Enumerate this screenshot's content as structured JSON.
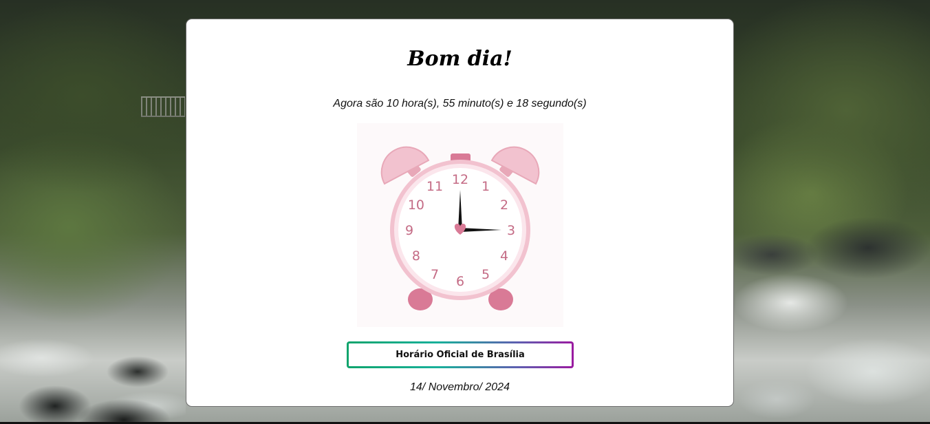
{
  "page": {
    "greeting": "Bom dia!",
    "time_text": "Agora são 10 hora(s), 55 minuto(s) e 18 segundo(s)",
    "official_time_button": "Horário Oficial de Brasília",
    "date_text": "14/ Novembro/ 2024"
  },
  "clock": {
    "icon": "alarm-clock-icon",
    "numerals": [
      "12",
      "1",
      "2",
      "3",
      "4",
      "5",
      "6",
      "7",
      "8",
      "9",
      "10",
      "11"
    ],
    "shown_hour": 3,
    "shown_minute": 0,
    "colors": {
      "pink_light": "#f2c2cf",
      "pink_medium": "#e8a8b8",
      "pink_dark": "#d97a96",
      "hands": "#111111",
      "numerals": "#c46b85"
    }
  },
  "button_gradient": [
    "#0fa46c",
    "#18b09a",
    "#5d5fb0",
    "#9a1aa0"
  ]
}
